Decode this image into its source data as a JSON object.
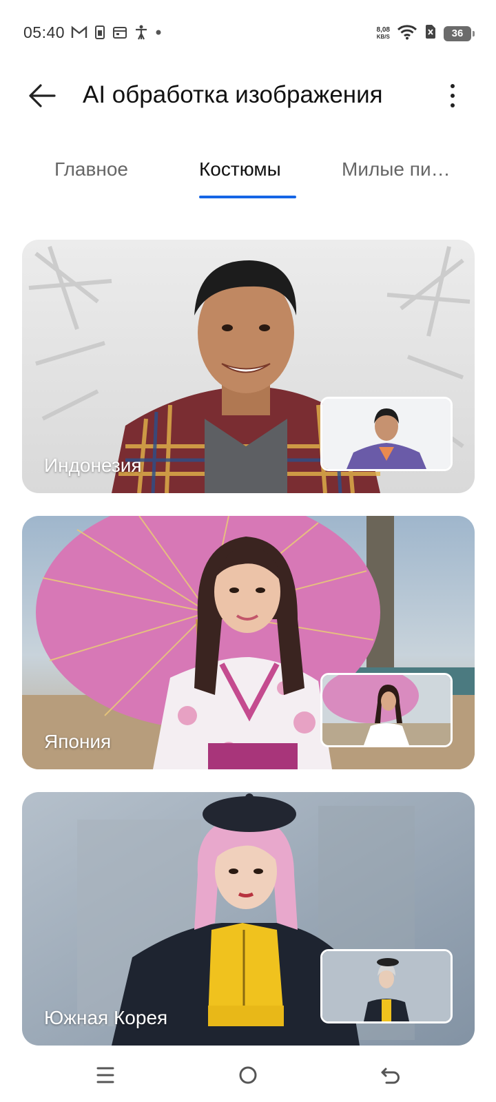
{
  "status_bar": {
    "time": "05:40",
    "net_speed_value": "8,08",
    "net_speed_unit": "KB/S",
    "battery_level": "36",
    "left_icons": [
      "gmail-icon",
      "sim-card-icon",
      "calendar-icon",
      "accessibility-icon",
      "dot-icon"
    ],
    "right_icons": [
      "wifi-icon",
      "no-sim-icon",
      "battery-icon"
    ]
  },
  "header": {
    "title": "AI обработка изображения",
    "back_icon": "arrow-left-icon",
    "more_icon": "more-vertical-icon"
  },
  "tabs": {
    "items": [
      {
        "label": "Главное",
        "active": false
      },
      {
        "label": "Костюмы",
        "active": true
      },
      {
        "label": "Милые пи…",
        "active": false
      }
    ],
    "accent_color": "#1565e5"
  },
  "cards": [
    {
      "label": "Индонезия"
    },
    {
      "label": "Япония"
    },
    {
      "label": "Южная Корея"
    }
  ],
  "nav_bar": {
    "icons": [
      "menu-icon",
      "home-icon",
      "back-icon"
    ]
  }
}
